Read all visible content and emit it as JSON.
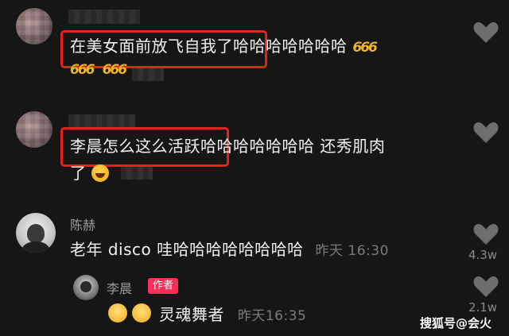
{
  "comments": [
    {
      "highlight": "在美女面前放飞自我了",
      "rest": "哈哈哈哈哈哈哈",
      "emoji_name": "666-emoji",
      "emoji_text": "666"
    },
    {
      "highlight": "李晨怎么这么活跃",
      "rest_line1": "哈哈哈哈哈哈哈 还秀肌肉",
      "rest_line2": "了",
      "emoji_name": "laughing-tears-emoji"
    },
    {
      "author": "陈赫",
      "text": "老年 disco 哇哈哈哈哈哈哈哈哈",
      "time": "昨天 16:30",
      "likes": "4.3w"
    }
  ],
  "reply": {
    "author": "李晨",
    "author_tag": "作者",
    "text": "灵魂舞者",
    "time": "昨天16:35",
    "likes": "2.1w"
  },
  "watermark": "搜狐号@会火",
  "colors": {
    "background": "#161616",
    "highlight_box": "#e0241b",
    "author_tag": "#ff2d55",
    "emoji_gold": "#f0b428"
  }
}
